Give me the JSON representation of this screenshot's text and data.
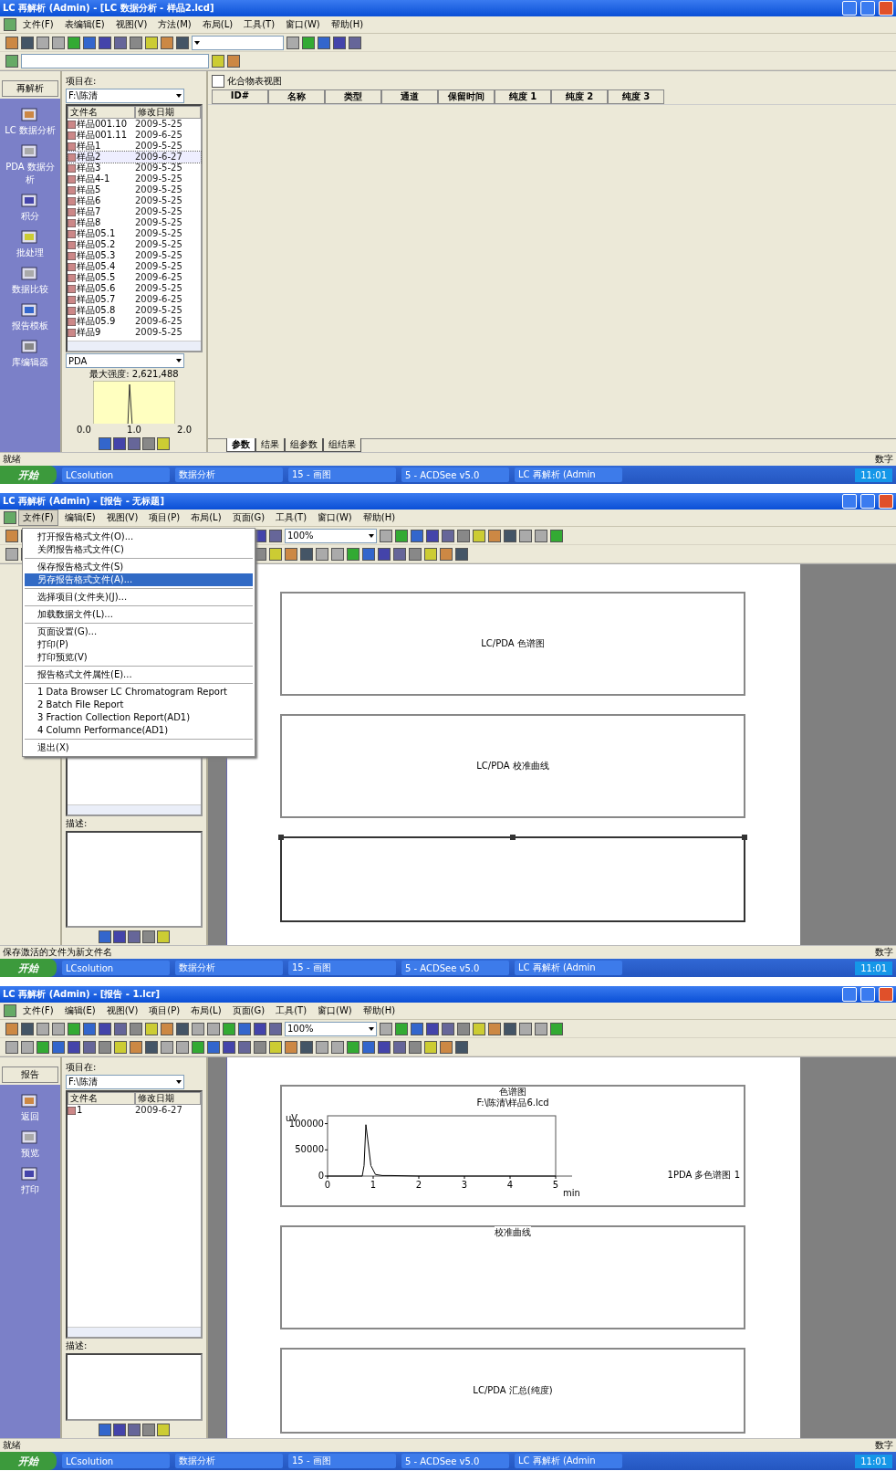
{
  "windows": [
    {
      "kind": "analysis",
      "title": "LC 再解析 (Admin) - [LC 数据分析 - 样品2.lcd]",
      "menu": [
        {
          "label": "文件(F)",
          "selected": false
        },
        {
          "label": "表编辑(E)",
          "selected": false
        },
        {
          "label": "视图(V)",
          "selected": false
        },
        {
          "label": "方法(M)",
          "selected": false
        },
        {
          "label": "布局(L)",
          "selected": false
        },
        {
          "label": "工具(T)",
          "selected": false
        },
        {
          "label": "窗口(W)",
          "selected": false
        },
        {
          "label": "帮助(H)",
          "selected": false
        }
      ],
      "nav": {
        "header": "再解析",
        "items": [
          "LC 数据分析",
          "PDA 数据分析",
          "积分",
          "批处理",
          "数据比较",
          "报告模板",
          "库编辑器"
        ]
      },
      "files": {
        "label": "项目在:",
        "folder": "F:\\陈清",
        "columns": [
          "文件名",
          "修改日期"
        ],
        "rows": [
          {
            "name": "样品001.10",
            "date": "2009-5-25",
            "selected": false
          },
          {
            "name": "样品001.11",
            "date": "2009-6-25",
            "selected": false
          },
          {
            "name": "样品1",
            "date": "2009-5-25",
            "selected": false
          },
          {
            "name": "样品2",
            "date": "2009-6-27",
            "selected": true
          },
          {
            "name": "样品3",
            "date": "2009-5-25",
            "selected": false
          },
          {
            "name": "样品4-1",
            "date": "2009-5-25",
            "selected": false
          },
          {
            "name": "样品5",
            "date": "2009-5-25",
            "selected": false
          },
          {
            "name": "样品6",
            "date": "2009-5-25",
            "selected": false
          },
          {
            "name": "样品7",
            "date": "2009-5-25",
            "selected": false
          },
          {
            "name": "样品8",
            "date": "2009-5-25",
            "selected": false
          },
          {
            "name": "样品05.1",
            "date": "2009-5-25",
            "selected": false
          },
          {
            "name": "样品05.2",
            "date": "2009-5-25",
            "selected": false
          },
          {
            "name": "样品05.3",
            "date": "2009-5-25",
            "selected": false
          },
          {
            "name": "样品05.4",
            "date": "2009-5-25",
            "selected": false
          },
          {
            "name": "样品05.5",
            "date": "2009-6-25",
            "selected": false
          },
          {
            "name": "样品05.6",
            "date": "2009-5-25",
            "selected": false
          },
          {
            "name": "样品05.7",
            "date": "2009-6-25",
            "selected": false
          },
          {
            "name": "样品05.8",
            "date": "2009-5-25",
            "selected": false
          },
          {
            "name": "样品05.9",
            "date": "2009-6-25",
            "selected": false
          },
          {
            "name": "样品9",
            "date": "2009-5-25",
            "selected": false
          }
        ],
        "preview": {
          "channel": "PDA",
          "title": "最大强度: 2,621,488",
          "x_labels": [
            "0.0",
            "1.0",
            "2.0"
          ]
        }
      },
      "main": {
        "kind": "table",
        "title": "化合物表视图",
        "columns": [
          "ID#",
          "名称",
          "类型",
          "通道",
          "保留时间",
          "纯度 1",
          "纯度 2",
          "纯度 3"
        ],
        "tabs": [
          {
            "label": "参数",
            "selected": true
          },
          {
            "label": "结果",
            "selected": false
          },
          {
            "label": "组参数",
            "selected": false
          },
          {
            "label": "组结果",
            "selected": false
          }
        ]
      },
      "status": "就绪",
      "status_right": "数字",
      "taskbar": {
        "start": "开始",
        "items": [
          "LCsolution",
          "数据分析",
          "15 - 画图",
          "5 - ACDSee v5.0",
          "LC 再解析 (Admin"
        ],
        "clock": "11:01"
      }
    },
    {
      "kind": "report",
      "title": "LC 再解析 (Admin) - [报告 - 无标题]",
      "zoom": "100%",
      "menu": [
        {
          "label": "文件(F)",
          "selected": true
        },
        {
          "label": "编辑(E)",
          "selected": false
        },
        {
          "label": "视图(V)",
          "selected": false
        },
        {
          "label": "项目(P)",
          "selected": false
        },
        {
          "label": "布局(L)",
          "selected": false
        },
        {
          "label": "页面(G)",
          "selected": false
        },
        {
          "label": "工具(T)",
          "selected": false
        },
        {
          "label": "窗口(W)",
          "selected": false
        },
        {
          "label": "帮助(H)",
          "selected": false
        }
      ],
      "dropdown": [
        [
          {
            "label": "打开报告格式文件(O)...",
            "selected": false
          },
          {
            "label": "关闭报告格式文件(C)",
            "selected": false
          }
        ],
        [
          {
            "label": "保存报告格式文件(S)",
            "selected": false
          },
          {
            "label": "另存报告格式文件(A)...",
            "selected": true
          }
        ],
        [
          {
            "label": "选择项目(文件夹)(J)...",
            "selected": false
          }
        ],
        [
          {
            "label": "加载数据文件(L)...",
            "selected": false
          }
        ],
        [
          {
            "label": "页面设置(G)...",
            "selected": false
          },
          {
            "label": "打印(P)",
            "selected": false
          },
          {
            "label": "打印预览(V)",
            "selected": false
          }
        ],
        [
          {
            "label": "报告格式文件属性(E)...",
            "selected": false
          }
        ],
        [
          {
            "label": "1 Data Browser LC Chromatogram Report",
            "selected": false
          },
          {
            "label": "2 Batch File Report",
            "selected": false
          },
          {
            "label": "3 Fraction Collection Report(AD1)",
            "selected": false
          },
          {
            "label": "4 Column Performance(AD1)",
            "selected": false
          }
        ],
        [
          {
            "label": "退出(X)",
            "selected": false
          }
        ]
      ],
      "files": {
        "description": "描述:"
      },
      "main": {
        "kind": "report",
        "sections": [
          {
            "kind": "placeholder",
            "label": "LC/PDA 色谱图",
            "selected": false
          },
          {
            "kind": "placeholder",
            "label": "LC/PDA 校准曲线",
            "selected": false
          },
          {
            "kind": "placeholder",
            "selected": true
          }
        ]
      },
      "status": "保存激活的文件为新文件名",
      "status_right": "数字",
      "taskbar": {
        "start": "开始",
        "items": [
          "LCsolution",
          "数据分析",
          "15 - 画图",
          "5 - ACDSee v5.0",
          "LC 再解析 (Admin"
        ],
        "clock": "11:01"
      }
    },
    {
      "kind": "report",
      "title": "LC 再解析 (Admin) - [报告 - 1.lcr]",
      "zoom": "100%",
      "menu": [
        {
          "label": "文件(F)",
          "selected": false
        },
        {
          "label": "编辑(E)",
          "selected": false
        },
        {
          "label": "视图(V)",
          "selected": false
        },
        {
          "label": "项目(P)",
          "selected": false
        },
        {
          "label": "布局(L)",
          "selected": false
        },
        {
          "label": "页面(G)",
          "selected": false
        },
        {
          "label": "工具(T)",
          "selected": false
        },
        {
          "label": "窗口(W)",
          "selected": false
        },
        {
          "label": "帮助(H)",
          "selected": false
        }
      ],
      "nav": {
        "header": "报告",
        "items": [
          "返回",
          "预览",
          "打印"
        ]
      },
      "files": {
        "label": "项目在:",
        "folder": "F:\\陈清",
        "columns": [
          "文件名",
          "修改日期"
        ],
        "rows": [
          {
            "name": "1",
            "date": "2009-6-27",
            "selected": false
          }
        ],
        "description": "描述:"
      },
      "main": {
        "kind": "report",
        "sections": [
          {
            "kind": "chart",
            "title": "色谱图",
            "subtitle": "F:\\陈清\\样品6.lcd",
            "chart_data": {
              "type": "line",
              "xlabel": "min",
              "ylabel": "uV",
              "x": [
                0,
                0.5,
                0.7,
                0.76,
                0.8,
                0.84,
                0.88,
                0.95,
                1.05,
                1.2,
                1.4,
                2,
                3,
                4,
                5
              ],
              "series": [
                {
                  "name": "1PDA 多色谱图 1",
                  "color": "#000000",
                  "values": [
                    0,
                    0,
                    0,
                    0,
                    20000,
                    98000,
                    70000,
                    20000,
                    3000,
                    1000,
                    1000,
                    0,
                    0,
                    0,
                    0
                  ]
                }
              ],
              "xlim": [
                0,
                5
              ],
              "ylim": [
                0,
                115000
              ],
              "xticks": [
                0,
                1,
                2,
                3,
                4,
                5
              ],
              "yticks": [
                0,
                50000,
                100000
              ]
            },
            "selected": false
          },
          {
            "kind": "titled",
            "label": "校准曲线",
            "selected": false
          },
          {
            "kind": "placeholder",
            "label": "LC/PDA 汇总(纯度)",
            "selected": false
          }
        ]
      },
      "status": "就绪",
      "status_right": "数字",
      "taskbar": {
        "start": "开始",
        "items": [
          "LCsolution",
          "数据分析",
          "15 - 画图",
          "5 - ACDSee v5.0",
          "LC 再解析 (Admin"
        ],
        "clock": "11:01"
      }
    }
  ]
}
